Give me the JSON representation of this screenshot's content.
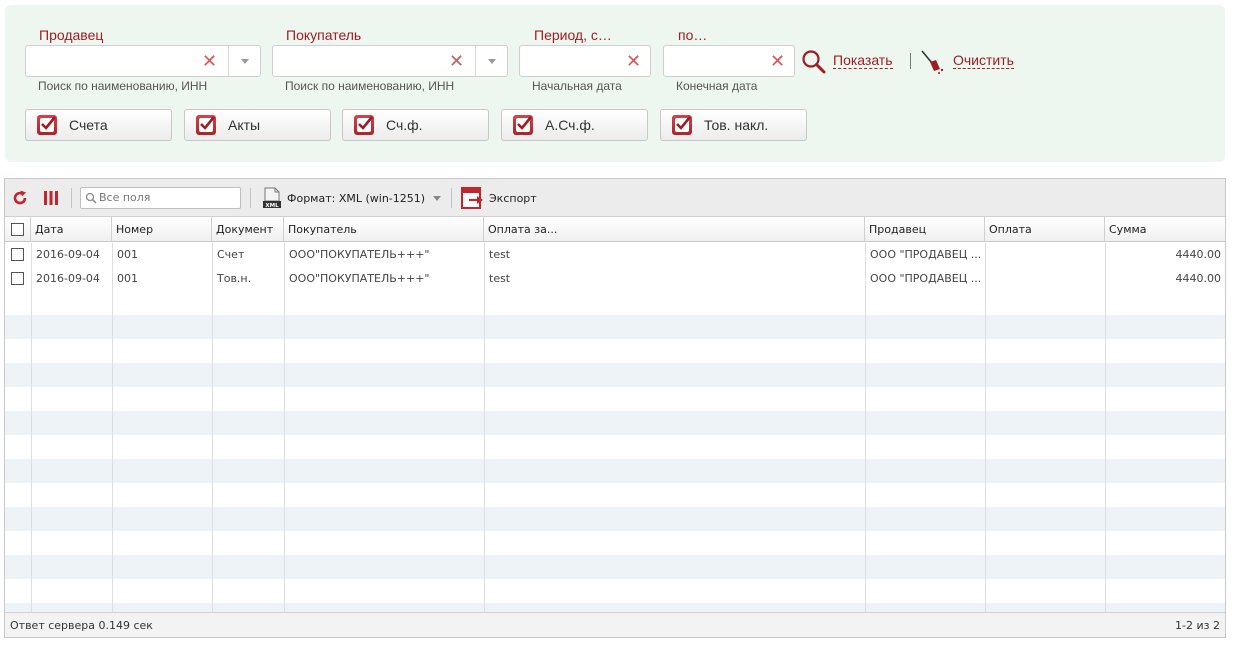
{
  "filters": {
    "seller": {
      "label": "Продавец",
      "value": "",
      "hint": "Поиск по наименованию, ИНН"
    },
    "buyer": {
      "label": "Покупатель",
      "value": "",
      "hint": "Поиск по наименованию, ИНН"
    },
    "period_from": {
      "label": "Период, с…",
      "value": "",
      "hint": "Начальная дата"
    },
    "period_to": {
      "label": "по…",
      "value": "",
      "hint": "Конечная дата"
    },
    "show_label": "Показать",
    "clear_label": "Очистить",
    "clear_glyph": "✕",
    "doc_types": [
      {
        "label": "Счета",
        "checked": true
      },
      {
        "label": "Акты",
        "checked": true
      },
      {
        "label": "Сч.ф.",
        "checked": true
      },
      {
        "label": "А.Сч.ф.",
        "checked": true
      },
      {
        "label": "Тов. накл.",
        "checked": true
      }
    ]
  },
  "toolbar": {
    "search_placeholder": "Все поля",
    "format_label": "Формат: XML (win-1251)",
    "export_label": "Экспорт"
  },
  "grid": {
    "columns": [
      "Дата",
      "Номер",
      "Документ",
      "Покупатель",
      "Оплата за...",
      "Продавец",
      "Оплата",
      "Сумма"
    ],
    "rows": [
      {
        "date": "2016-09-04",
        "number": "001",
        "document": "Счет",
        "buyer": "ООО\"ПОКУПАТЕЛЬ+++\"",
        "payment_for": "test",
        "seller": "ООО \"ПРОДАВЕЦ ...",
        "payment": "",
        "amount": "4440.00"
      },
      {
        "date": "2016-09-04",
        "number": "001",
        "document": "Тов.н.",
        "buyer": "ООО\"ПОКУПАТЕЛЬ+++\"",
        "payment_for": "test",
        "seller": "ООО \"ПРОДАВЕЦ ...",
        "payment": "",
        "amount": "4440.00"
      }
    ]
  },
  "footer": {
    "server_response": "Ответ сервера 0.149 сек",
    "paging": "1-2 из 2"
  },
  "colors": {
    "accent": "#a01c24",
    "filter_bg": "#eef7ef",
    "row_alt": "#eef3f8"
  }
}
